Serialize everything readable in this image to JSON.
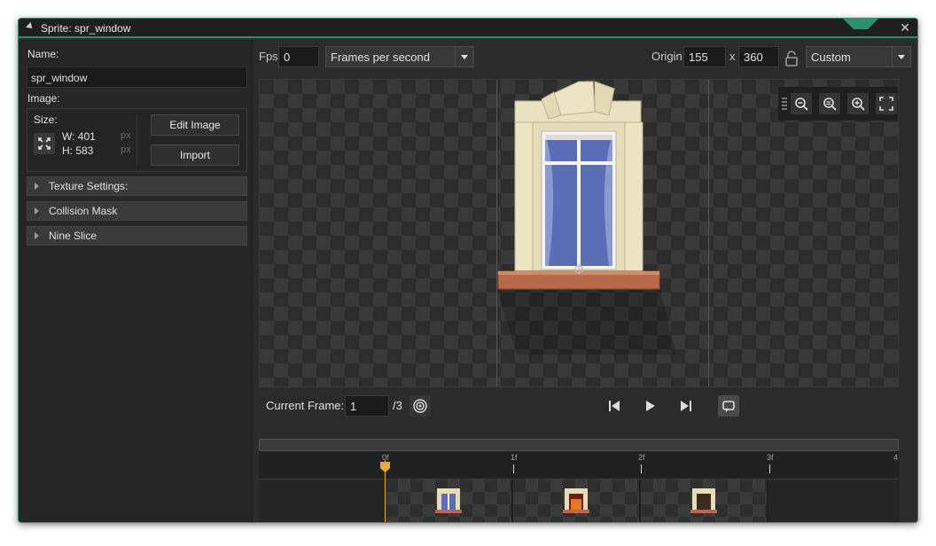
{
  "window": {
    "title": "Sprite: spr_window"
  },
  "left": {
    "name_label": "Name:",
    "name_value": "spr_window",
    "image_label": "Image:",
    "size_label": "Size:",
    "width_text": "W: 401",
    "height_text": "H: 583",
    "px_unit": "px",
    "edit_image": "Edit Image",
    "import": "Import",
    "sections": [
      "Texture Settings:",
      "Collision Mask",
      "Nine Slice"
    ]
  },
  "toolbar": {
    "fps_label": "Fps",
    "fps_value": "0",
    "fps_mode": "Frames per second",
    "origin_label": "Origin",
    "origin_x": "155",
    "origin_sep": "x",
    "origin_y": "360",
    "origin_mode": "Custom"
  },
  "playback": {
    "current_frame_label": "Current Frame:",
    "current_frame_value": "1",
    "frame_total": "/3"
  },
  "timeline": {
    "ticks": [
      "0f",
      "1f",
      "2f",
      "3f",
      "4"
    ]
  },
  "colors": {
    "accent": "#2e8f6e",
    "playhead": "#e8a93a"
  }
}
